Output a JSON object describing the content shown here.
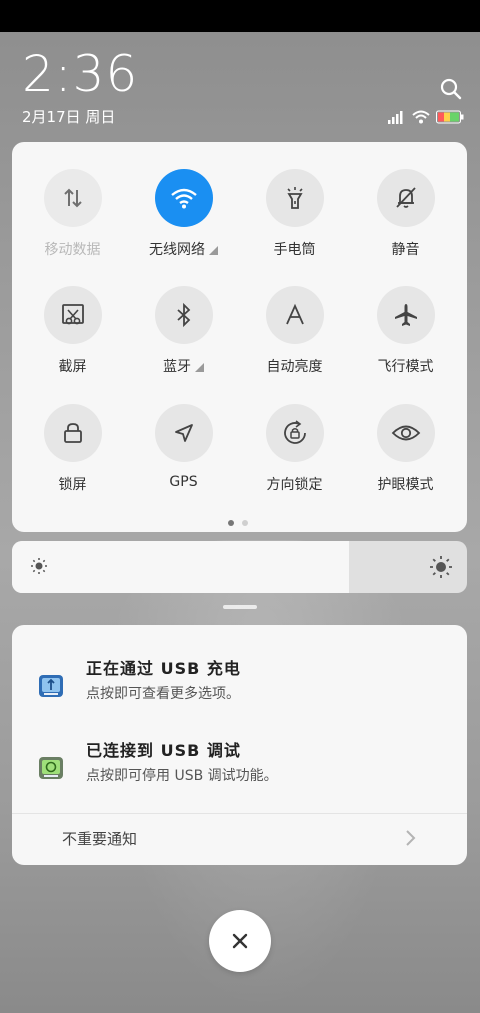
{
  "status": {
    "time": "2:36",
    "date": "2月17日 周日"
  },
  "quick_settings": [
    {
      "label": "移动数据",
      "icon": "mobile-data-icon",
      "active": false,
      "dim": true,
      "expand": false
    },
    {
      "label": "无线网络",
      "icon": "wifi-icon",
      "active": true,
      "dim": false,
      "expand": true
    },
    {
      "label": "手电筒",
      "icon": "flashlight-icon",
      "active": false,
      "dim": false,
      "expand": false
    },
    {
      "label": "静音",
      "icon": "mute-bell-icon",
      "active": false,
      "dim": false,
      "expand": false
    },
    {
      "label": "截屏",
      "icon": "screenshot-icon",
      "active": false,
      "dim": false,
      "expand": false
    },
    {
      "label": "蓝牙",
      "icon": "bluetooth-icon",
      "active": false,
      "dim": false,
      "expand": true
    },
    {
      "label": "自动亮度",
      "icon": "auto-brightness-icon",
      "active": false,
      "dim": false,
      "expand": false
    },
    {
      "label": "飞行模式",
      "icon": "airplane-icon",
      "active": false,
      "dim": false,
      "expand": false
    },
    {
      "label": "锁屏",
      "icon": "lock-icon",
      "active": false,
      "dim": false,
      "expand": false
    },
    {
      "label": "GPS",
      "icon": "gps-icon",
      "active": false,
      "dim": false,
      "expand": false
    },
    {
      "label": "方向锁定",
      "icon": "rotation-lock-icon",
      "active": false,
      "dim": false,
      "expand": false
    },
    {
      "label": "护眼模式",
      "icon": "eye-icon",
      "active": false,
      "dim": false,
      "expand": false
    }
  ],
  "pager": {
    "pages": 2,
    "current": 1
  },
  "brightness": {
    "level": 0.74
  },
  "notifications": [
    {
      "title": "正在通过 USB 充电",
      "body": "点按即可查看更多选项。",
      "icon": "usb-charging-icon"
    },
    {
      "title": "已连接到 USB 调试",
      "body": "点按即可停用 USB 调试功能。",
      "icon": "android-debug-icon"
    }
  ],
  "unimportant_label": "不重要通知",
  "colors": {
    "accent": "#1a8ff2",
    "panel": "#f7f7f7"
  }
}
